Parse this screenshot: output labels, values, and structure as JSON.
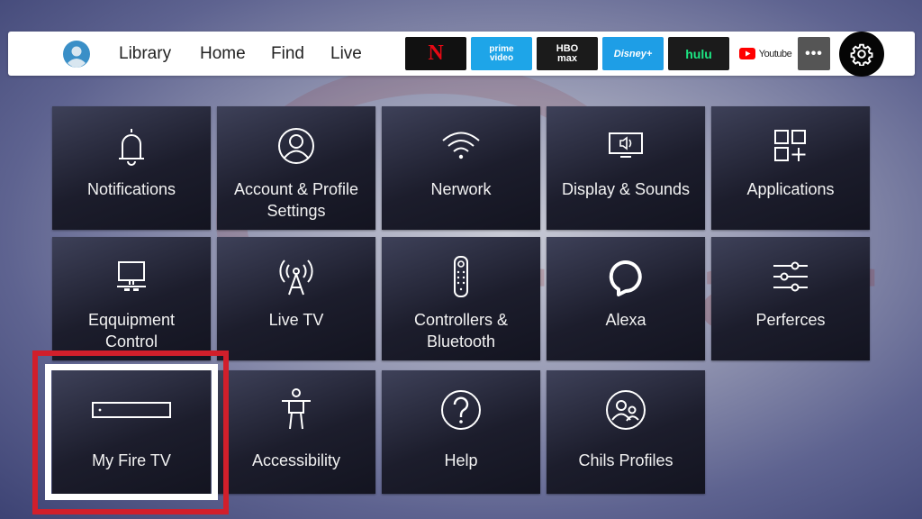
{
  "topbar": {
    "nav": [
      "Library",
      "Home",
      "Find",
      "Live"
    ],
    "apps": {
      "netflix": "N",
      "prime": [
        "prime",
        "video"
      ],
      "hbo": [
        "HBO",
        "max"
      ],
      "disney": "Disney+",
      "hulu": "hulu",
      "youtube": "Youtube",
      "more": "•••"
    }
  },
  "tiles": [
    {
      "label": "Notifications",
      "icon": "bell-icon"
    },
    {
      "label": "Account & Profile Settings",
      "icon": "user-circle-icon"
    },
    {
      "label": "Nerwork",
      "icon": "wifi-icon"
    },
    {
      "label": "Display & Sounds",
      "icon": "tv-sound-icon"
    },
    {
      "label": "Applications",
      "icon": "apps-grid-icon"
    },
    {
      "label": "Eqquipment Control",
      "icon": "monitor-icon"
    },
    {
      "label": "Live TV",
      "icon": "antenna-icon"
    },
    {
      "label": "Controllers & Bluetooth",
      "icon": "remote-icon"
    },
    {
      "label": "Alexa",
      "icon": "alexa-ring-icon"
    },
    {
      "label": "Perferces",
      "icon": "sliders-icon"
    },
    {
      "label": "My Fire TV",
      "icon": "fire-tv-device-icon"
    },
    {
      "label": "Accessibility",
      "icon": "accessibility-person-icon"
    },
    {
      "label": "Help",
      "icon": "help-icon"
    },
    {
      "label": "Chils Profiles",
      "icon": "child-profiles-icon"
    }
  ],
  "watermark": "repair",
  "colors": {
    "highlight": "#d11f2b",
    "netflix_red": "#e50914",
    "prime_blue": "#1ea5e8",
    "disney_blue": "#1e9ee6",
    "hulu_green": "#1ce783"
  }
}
